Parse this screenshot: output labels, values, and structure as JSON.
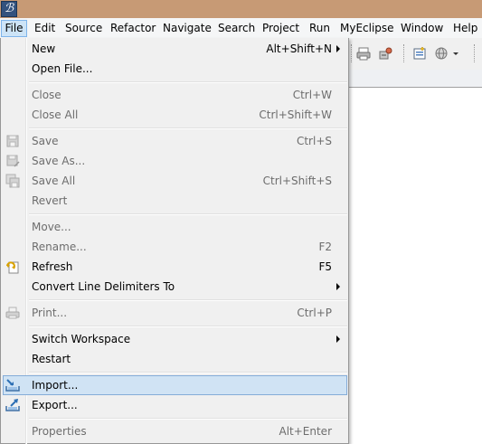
{
  "app": {
    "icon_glyph": "ℬ",
    "icon_name": "myeclipse-logo-icon"
  },
  "menubar": {
    "items": [
      "File",
      "Edit",
      "Source",
      "Refactor",
      "Navigate",
      "Search",
      "Project",
      "Run",
      "MyEclipse",
      "Window",
      "Help"
    ],
    "active": "File"
  },
  "toolbar": {
    "icons": [
      "print-icon",
      "deploy-icon",
      "new-project-icon",
      "globe-icon",
      "dropdown-arrow-icon"
    ]
  },
  "file_menu": {
    "new": {
      "label": "New",
      "shortcut": "Alt+Shift+N"
    },
    "open_file": {
      "label": "Open File..."
    },
    "close": {
      "label": "Close",
      "shortcut": "Ctrl+W"
    },
    "close_all": {
      "label": "Close All",
      "shortcut": "Ctrl+Shift+W"
    },
    "save": {
      "label": "Save",
      "shortcut": "Ctrl+S"
    },
    "save_as": {
      "label": "Save As..."
    },
    "save_all": {
      "label": "Save All",
      "shortcut": "Ctrl+Shift+S"
    },
    "revert": {
      "label": "Revert"
    },
    "move": {
      "label": "Move..."
    },
    "rename": {
      "label": "Rename...",
      "shortcut": "F2"
    },
    "refresh": {
      "label": "Refresh",
      "shortcut": "F5"
    },
    "convert": {
      "label": "Convert Line Delimiters To"
    },
    "print": {
      "label": "Print...",
      "shortcut": "Ctrl+P"
    },
    "switch_workspace": {
      "label": "Switch Workspace"
    },
    "restart": {
      "label": "Restart"
    },
    "import": {
      "label": "Import..."
    },
    "export": {
      "label": "Export..."
    },
    "properties": {
      "label": "Properties",
      "shortcut": "Alt+Enter"
    }
  },
  "colors": {
    "titlebar": "#c79a75",
    "menu_bg": "#f0f0f0",
    "highlight": "#d0e3f4",
    "highlight_border": "#84acd8",
    "disabled_text": "#6d6d6d"
  }
}
